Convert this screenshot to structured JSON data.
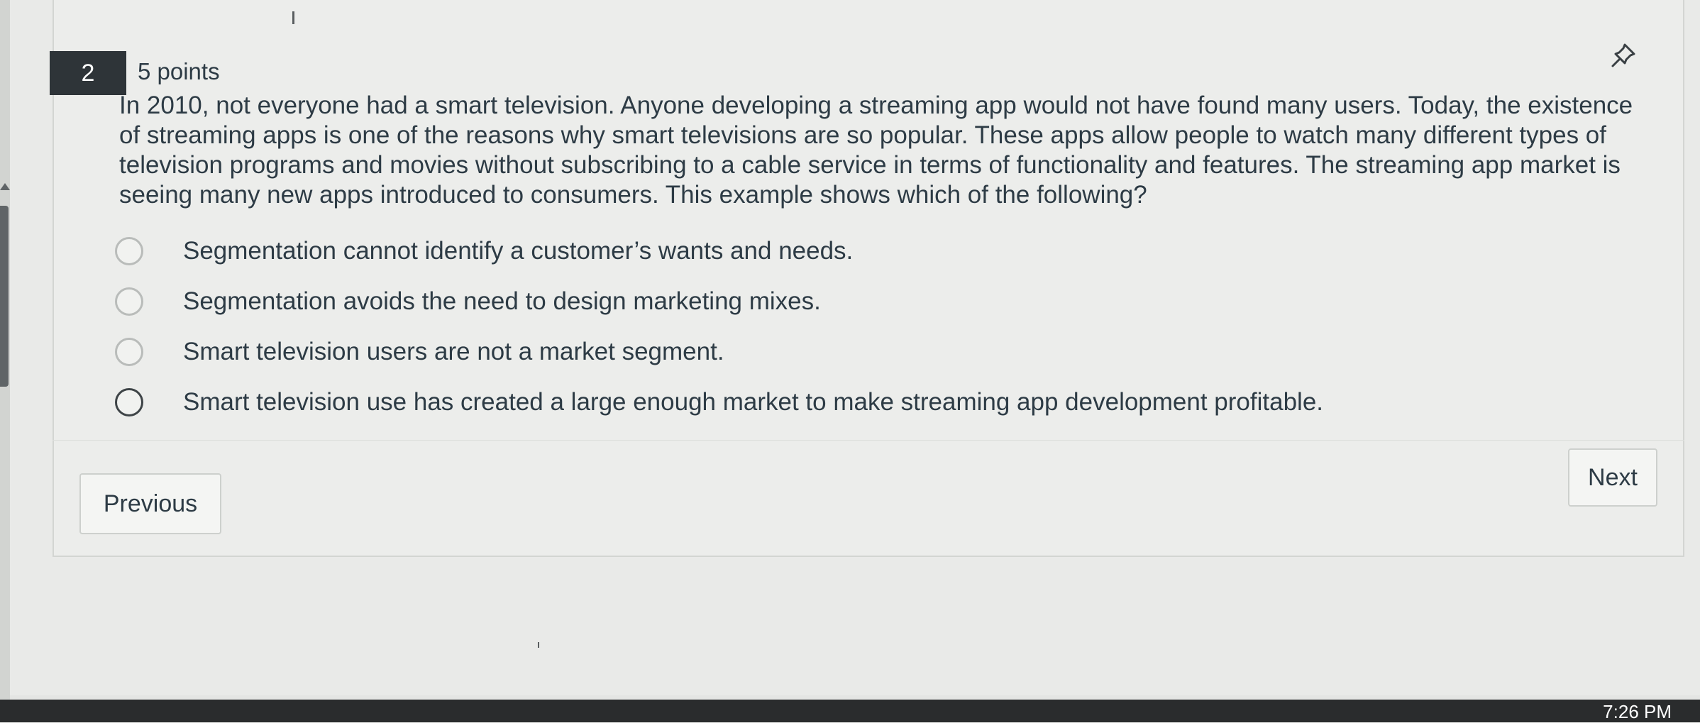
{
  "question": {
    "number": "2",
    "points": "5 points",
    "text": "In 2010, not everyone had a smart television. Anyone developing a streaming app would not have found many users. Today, the existence of streaming apps is one of the reasons why smart televisions are so popular. These apps allow people to watch many different types of television programs and movies without subscribing to a cable service in terms of functionality and features. The streaming app market is seeing many new apps introduced to consumers. This example shows which of the following?",
    "answers": [
      {
        "label": "Segmentation cannot identify a customer’s wants and needs.",
        "selected": false
      },
      {
        "label": "Segmentation avoids the need to design marketing mixes.",
        "selected": false
      },
      {
        "label": "Smart television users are not a market segment.",
        "selected": false
      },
      {
        "label": "Smart television use has created a large enough market to make streaming app development profitable.",
        "selected": false
      }
    ]
  },
  "navigation": {
    "previous_label": "Previous",
    "next_label": "Next"
  },
  "taskbar": {
    "clock": "7:26 PM"
  },
  "icons": {
    "pin": "pin-icon"
  },
  "colors": {
    "question_number_bg": "#2e3438",
    "text": "#2d3b45",
    "page_bg": "#e9eae8"
  }
}
